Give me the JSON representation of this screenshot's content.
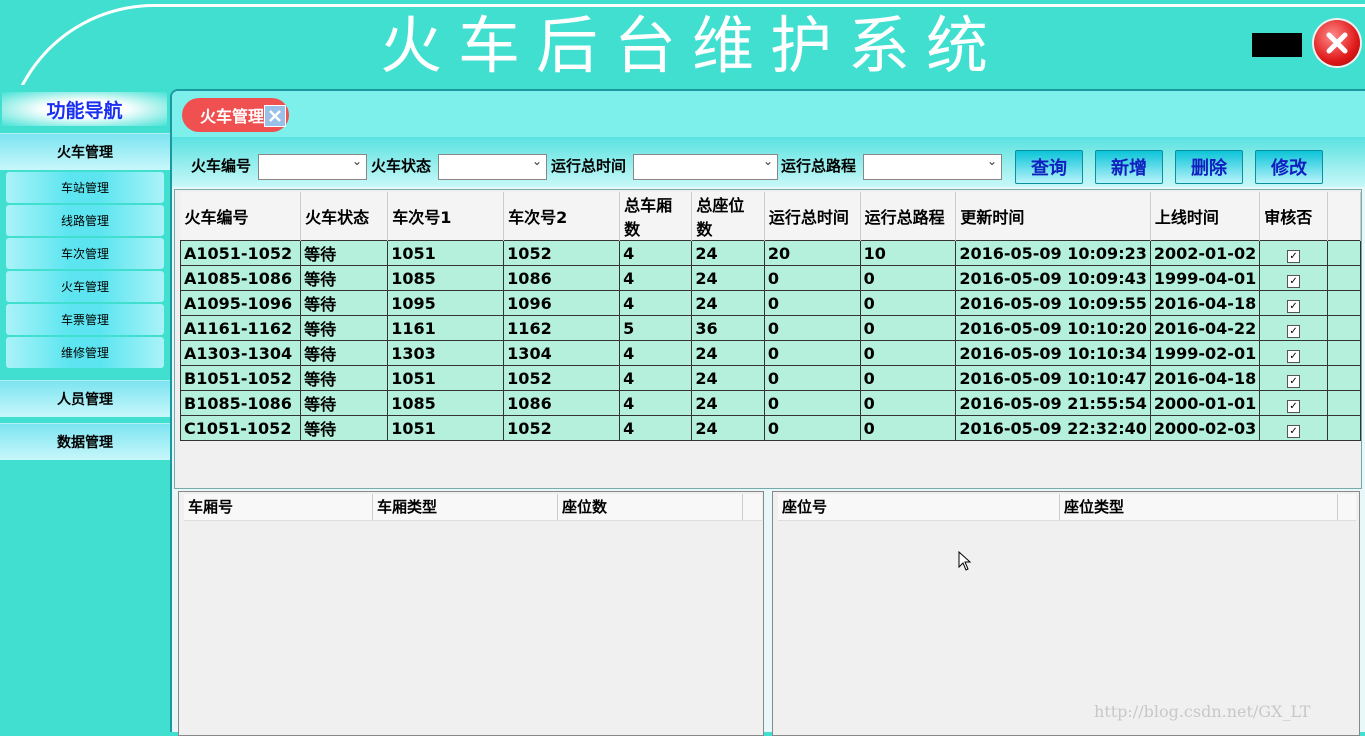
{
  "app": {
    "title": "火车后台维护系统"
  },
  "sidebar": {
    "nav_title": "功能导航",
    "groups": [
      {
        "label": "火车管理",
        "items": [
          "车站管理",
          "线路管理",
          "车次管理",
          "火车管理",
          "车票管理",
          "维修管理"
        ]
      },
      {
        "label": "人员管理"
      },
      {
        "label": "数据管理"
      }
    ]
  },
  "tab": {
    "label": "火车管理"
  },
  "toolbar": {
    "filters": [
      "火车编号",
      "火车状态",
      "运行总时间",
      "运行总路程"
    ],
    "buttons": {
      "query": "查询",
      "add": "新增",
      "delete": "删除",
      "edit": "修改"
    }
  },
  "table": {
    "columns": [
      "火车编号",
      "火车状态",
      "车次号1",
      "车次号2",
      "总车厢数",
      "总座位数",
      "运行总时间",
      "运行总路程",
      "更新时间",
      "上线时间",
      "审核否"
    ],
    "rows": [
      [
        "A1051-1052",
        "等待",
        "1051",
        "1052",
        "4",
        "24",
        "20",
        "10",
        "2016-05-09 10:09:23",
        "2002-01-02",
        "✓"
      ],
      [
        "A1085-1086",
        "等待",
        "1085",
        "1086",
        "4",
        "24",
        "0",
        "0",
        "2016-05-09 10:09:43",
        "1999-04-01",
        "✓"
      ],
      [
        "A1095-1096",
        "等待",
        "1095",
        "1096",
        "4",
        "24",
        "0",
        "0",
        "2016-05-09 10:09:55",
        "2016-04-18",
        "✓"
      ],
      [
        "A1161-1162",
        "等待",
        "1161",
        "1162",
        "5",
        "36",
        "0",
        "0",
        "2016-05-09 10:10:20",
        "2016-04-22",
        "✓"
      ],
      [
        "A1303-1304",
        "等待",
        "1303",
        "1304",
        "4",
        "24",
        "0",
        "0",
        "2016-05-09 10:10:34",
        "1999-02-01",
        "✓"
      ],
      [
        "B1051-1052",
        "等待",
        "1051",
        "1052",
        "4",
        "24",
        "0",
        "0",
        "2016-05-09 10:10:47",
        "2016-04-18",
        "✓"
      ],
      [
        "B1085-1086",
        "等待",
        "1085",
        "1086",
        "4",
        "24",
        "0",
        "0",
        "2016-05-09 21:55:54",
        "2000-01-01",
        "✓"
      ],
      [
        "C1051-1052",
        "等待",
        "1051",
        "1052",
        "4",
        "24",
        "0",
        "0",
        "2016-05-09 22:32:40",
        "2000-02-03",
        "✓"
      ]
    ]
  },
  "carriage_table": {
    "columns": [
      "车厢号",
      "车厢类型",
      "座位数"
    ]
  },
  "seat_table": {
    "columns": [
      "座位号",
      "座位类型"
    ]
  },
  "watermark": "http://blog.csdn.net/GX_LT"
}
